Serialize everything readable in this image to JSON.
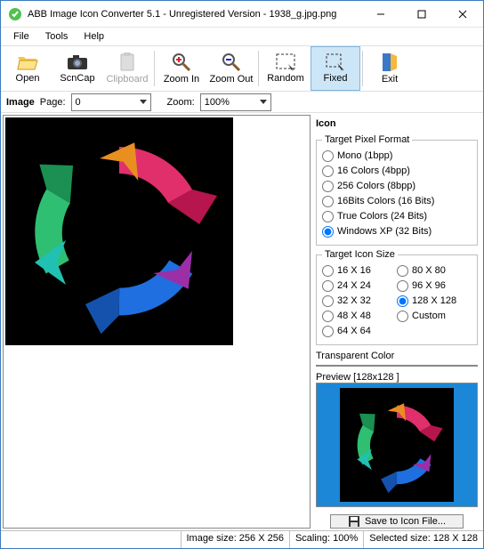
{
  "window": {
    "title": "ABB Image Icon Converter 5.1 - Unregistered Version - 1938_g.jpg.png"
  },
  "menu": {
    "file": "File",
    "tools": "Tools",
    "help": "Help"
  },
  "toolbar": {
    "open": "Open",
    "scncap": "ScnCap",
    "clipboard": "Clipboard",
    "zoomin": "Zoom In",
    "zoomout": "Zoom Out",
    "random": "Random",
    "fixed": "Fixed",
    "exit": "Exit"
  },
  "optbar": {
    "image_label": "Image",
    "page_label": "Page:",
    "page_value": "0",
    "zoom_label": "Zoom:",
    "zoom_value": "100%"
  },
  "right": {
    "icon_label": "Icon",
    "pixfmt": {
      "legend": "Target Pixel Format",
      "mono": "Mono (1bpp)",
      "c16": "16 Colors (4bpp)",
      "c256": "256 Colors (8bpp)",
      "b16": "16Bits Colors (16 Bits)",
      "true": "True Colors (24 Bits)",
      "xp": "Windows XP (32 Bits)"
    },
    "size": {
      "legend": "Target Icon Size",
      "s16": "16 X 16",
      "s24": "24 X 24",
      "s32": "32 X 32",
      "s48": "48 X 48",
      "s64": "64 X 64",
      "s80": "80 X 80",
      "s96": "96 X 96",
      "s128": "128 X 128",
      "custom": "Custom"
    },
    "transparent_label": "Transparent Color",
    "transparent_color": "#ccff00",
    "preview_label": "Preview [128x128 ]",
    "save_label": "Save to Icon File..."
  },
  "status": {
    "imgsize": "Image size: 256 X 256",
    "scaling": "Scaling: 100%",
    "selsize": "Selected size: 128 X 128"
  }
}
